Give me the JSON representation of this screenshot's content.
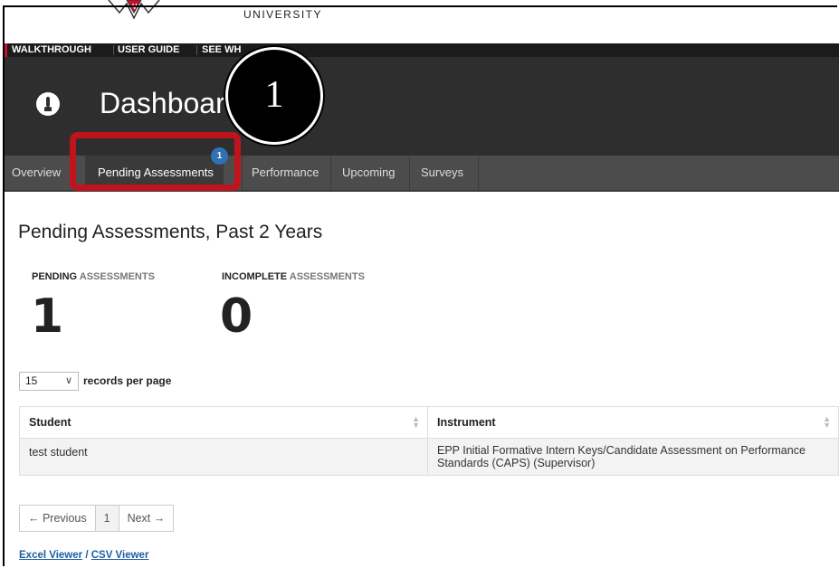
{
  "branding": {
    "university": "UNIVERSITY"
  },
  "top_links": [
    "WALKTHROUGH",
    "USER GUIDE",
    "SEE WH"
  ],
  "header": {
    "title": "Dashboard"
  },
  "tabs": [
    {
      "label": "Overview"
    },
    {
      "label": "Pending Assessments",
      "badge": "1"
    },
    {
      "label": "Performance"
    },
    {
      "label": "Upcoming"
    },
    {
      "label": "Surveys"
    }
  ],
  "callout": {
    "number": "1"
  },
  "section_title": "Pending Assessments, Past 2 Years",
  "stats": [
    {
      "label_a": "PENDING",
      "label_b": "ASSESSMENTS",
      "value": "1"
    },
    {
      "label_a": "INCOMPLETE",
      "label_b": "ASSESSMENTS",
      "value": "0"
    }
  ],
  "records": {
    "selected": "15",
    "label": "records per page"
  },
  "table": {
    "columns": [
      "Student",
      "Instrument"
    ],
    "rows": [
      [
        "test student",
        "EPP Initial Formative Intern Keys/Candidate Assessment on Performance Standards (CAPS) (Supervisor)"
      ]
    ]
  },
  "pager": {
    "prev": "← Previous",
    "current": "1",
    "next": "Next →"
  },
  "exports": {
    "excel": "Excel Viewer",
    "separator": " / ",
    "csv": "CSV Viewer"
  },
  "colors": {
    "header_bg": "#2e2e2e",
    "tab_bg": "#4c4c4c",
    "callout_red": "#c0141c",
    "badge_blue": "#2f72b3",
    "link_blue": "#1a5fa0"
  },
  "icons": {
    "dashboard": "gauge-icon",
    "select": "chevron-down-icon",
    "sort": "sort-icon"
  }
}
